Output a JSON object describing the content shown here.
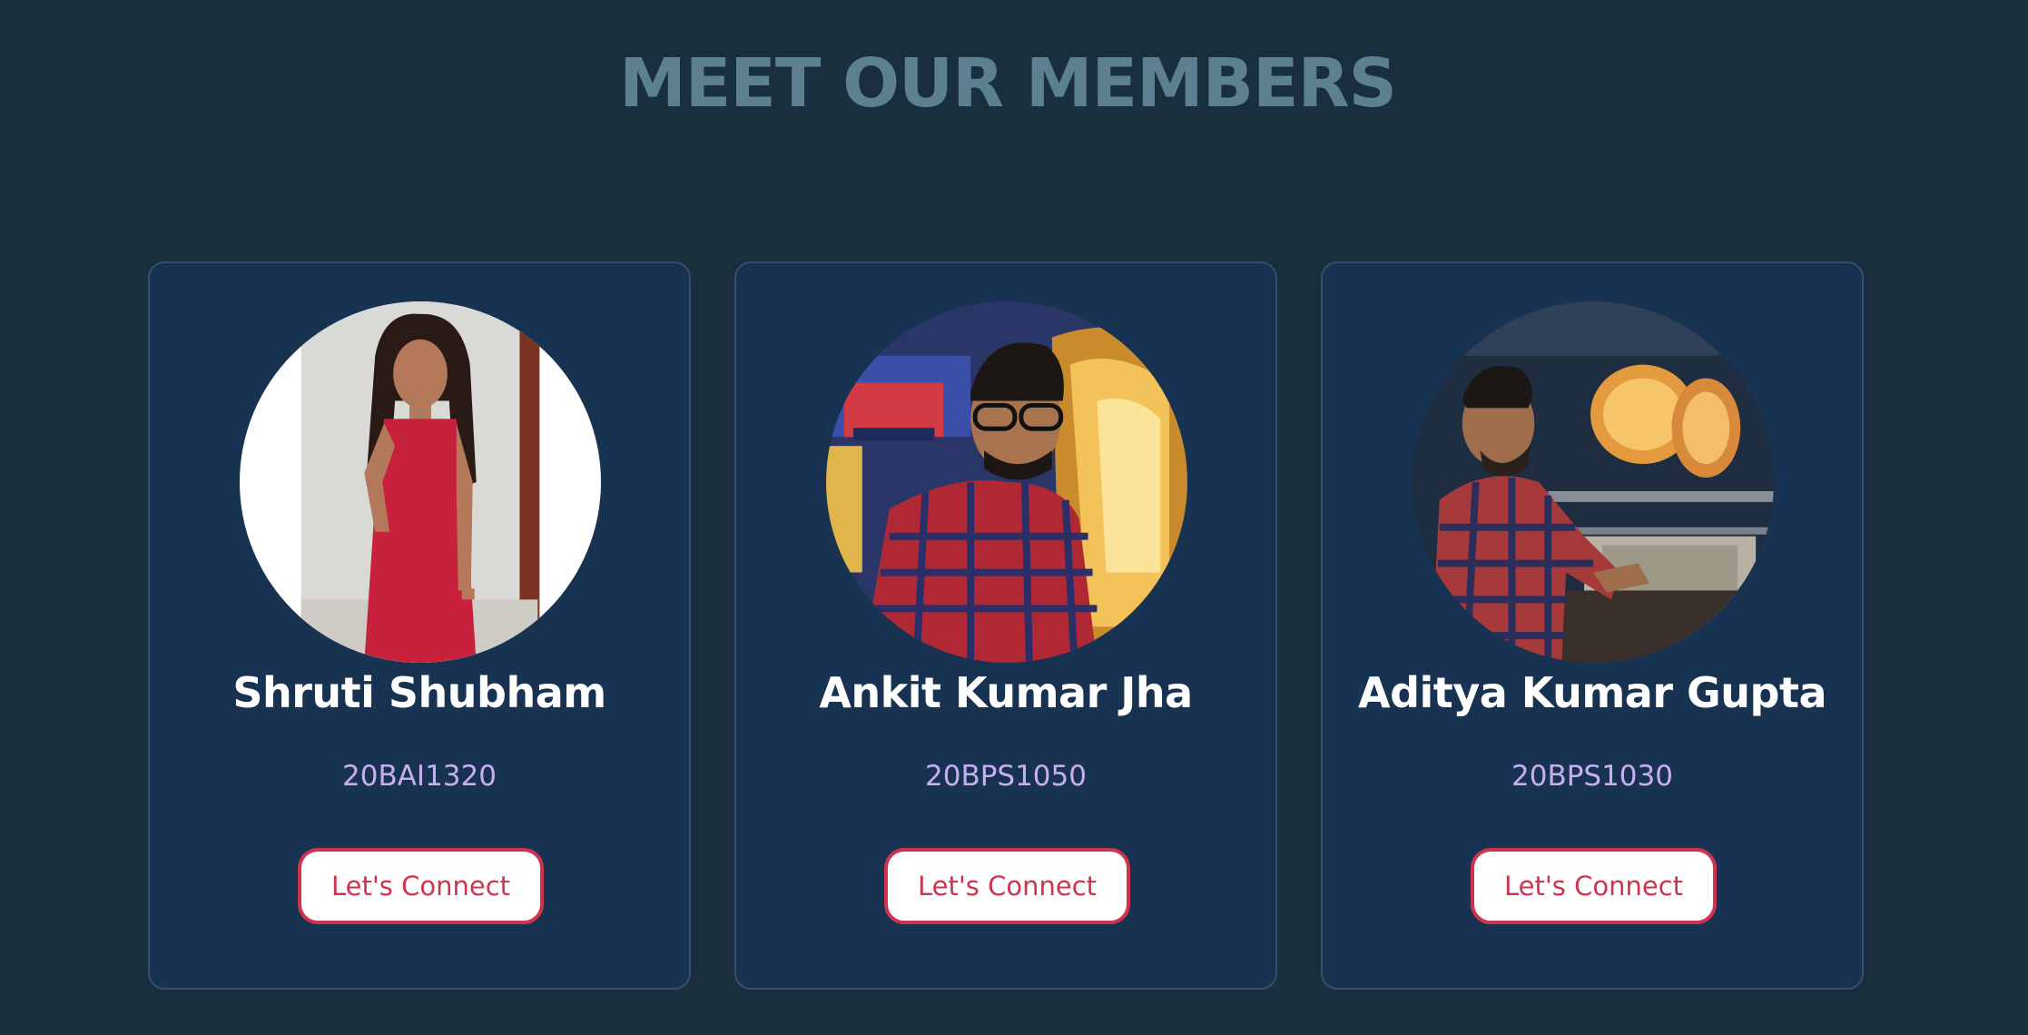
{
  "page": {
    "title": "MEET OUR MEMBERS"
  },
  "members": [
    {
      "name": "Shruti Shubham",
      "id": "20BAI1320",
      "button_label": "Let's Connect",
      "avatar": "member-photo"
    },
    {
      "name": "Ankit Kumar Jha",
      "id": "20BPS1050",
      "button_label": "Let's Connect",
      "avatar": "member-photo"
    },
    {
      "name": "Aditya Kumar Gupta",
      "id": "20BPS1030",
      "button_label": "Let's Connect",
      "avatar": "member-photo"
    }
  ],
  "colors": {
    "background": "#1a2f3e",
    "card": "#183251",
    "card_border": "#35506b",
    "title": "#5d8091",
    "name": "#ffffff",
    "member_id": "#c7aef0",
    "button_accent": "#d0334f"
  }
}
